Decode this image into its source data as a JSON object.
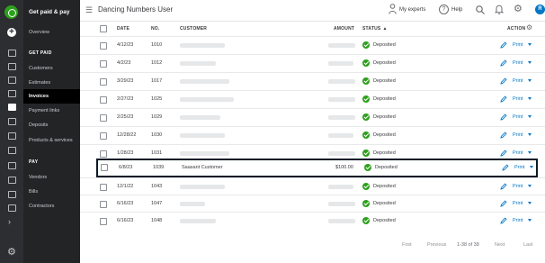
{
  "nav": {
    "title": "Get paid & pay",
    "items": [
      {
        "label": "Overview"
      },
      {
        "label": "Customers"
      },
      {
        "label": "Estimates"
      },
      {
        "label": "Invoices"
      },
      {
        "label": "Payment links"
      },
      {
        "label": "Deposits"
      },
      {
        "label": "Products & services"
      },
      {
        "label": "Vendors"
      },
      {
        "label": "Bills"
      },
      {
        "label": "Contractors"
      }
    ],
    "sections": {
      "get_paid": "GET PAID",
      "pay": "PAY"
    },
    "active_item": "Invoices"
  },
  "header": {
    "company_name": "Dancing Numbers User",
    "experts_label": "My experts",
    "help_label": "Help",
    "avatar_initial": "R"
  },
  "table": {
    "columns": {
      "date": "DATE",
      "no": "NO.",
      "customer": "CUSTOMER",
      "amount": "AMOUNT",
      "status": "STATUS",
      "action": "ACTION"
    },
    "sort_indicator": "▲",
    "rows": [
      {
        "date": "4/12/23",
        "no": "1010",
        "customer": "",
        "amount": "",
        "status": "Deposited",
        "action": "Print"
      },
      {
        "date": "4/2/23",
        "no": "1012",
        "customer": "",
        "amount": "",
        "status": "Deposited",
        "action": "Print"
      },
      {
        "date": "3/29/23",
        "no": "1017",
        "customer": "",
        "amount": "",
        "status": "Deposited",
        "action": "Print"
      },
      {
        "date": "2/27/23",
        "no": "1025",
        "customer": "",
        "amount": "",
        "status": "Deposited",
        "action": "Print"
      },
      {
        "date": "2/25/23",
        "no": "1029",
        "customer": "",
        "amount": "",
        "status": "Deposited",
        "action": "Print"
      },
      {
        "date": "12/28/22",
        "no": "1030",
        "customer": "",
        "amount": "",
        "status": "Deposited",
        "action": "Print"
      },
      {
        "date": "1/28/23",
        "no": "1031",
        "customer": "",
        "amount": "",
        "status": "Deposited",
        "action": "Print"
      },
      {
        "date": "6/8/23",
        "no": "1039",
        "customer": "Saasant Customer",
        "amount": "$100.00",
        "status": "Deposited",
        "action": "Print"
      },
      {
        "date": "12/1/22",
        "no": "1043",
        "customer": "",
        "amount": "",
        "status": "Deposited",
        "action": "Print"
      },
      {
        "date": "6/16/23",
        "no": "1047",
        "customer": "",
        "amount": "",
        "status": "Deposited",
        "action": "Print"
      },
      {
        "date": "6/16/23",
        "no": "1048",
        "customer": "",
        "amount": "",
        "status": "Deposited",
        "action": "Print"
      }
    ],
    "highlighted_row": 7
  },
  "pagination": {
    "first": "First",
    "previous": "Previous",
    "range": "1-38 of 38",
    "next": "Next",
    "last": "Last"
  },
  "colors": {
    "brand_green": "#2ca01c",
    "link_blue": "#0077c5",
    "sidebar_dark": "#232426",
    "highlight_border": "#0b1b28"
  }
}
